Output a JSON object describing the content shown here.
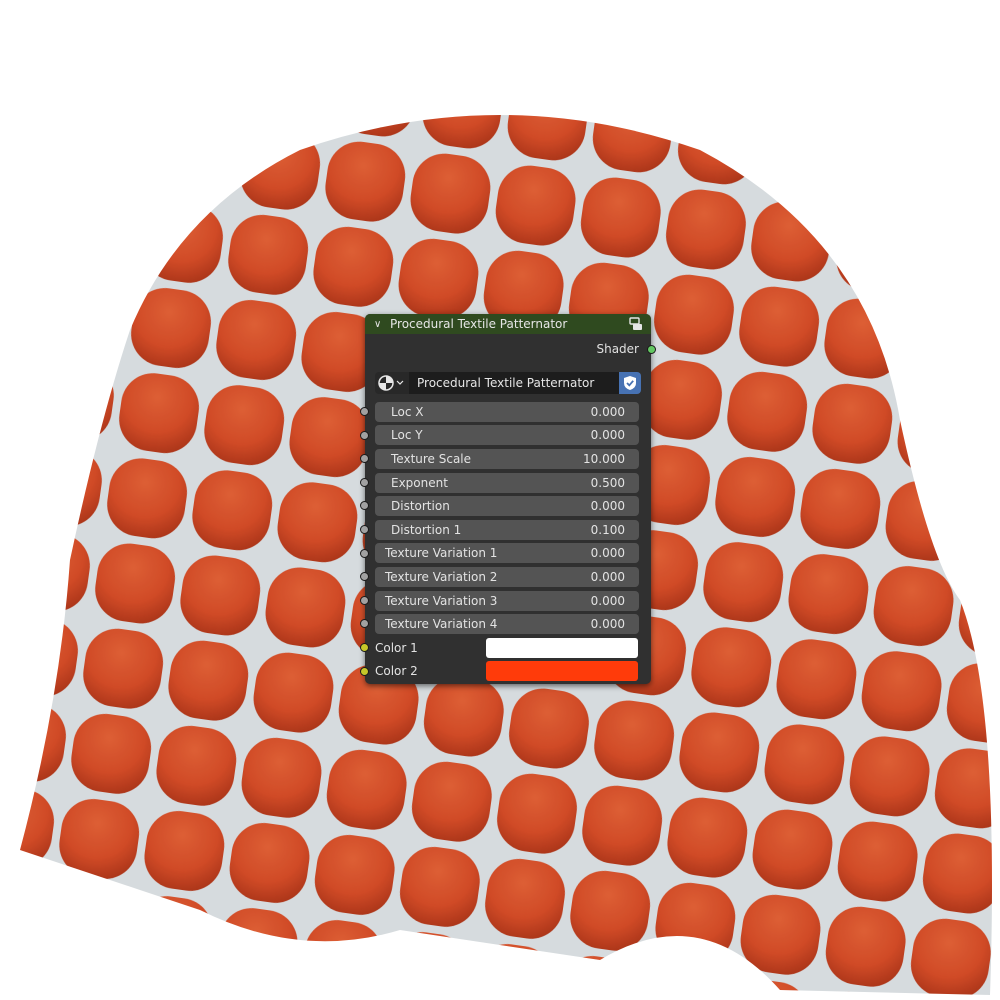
{
  "node": {
    "title": "Procedural Textile Patternator",
    "header_color": "#2f4a1f",
    "output_label": "Shader",
    "group_name": "Procedural Textile Patternator",
    "fields": [
      {
        "label": "Loc X",
        "value": "0.000"
      },
      {
        "label": "Loc Y",
        "value": "0.000"
      },
      {
        "label": "Texture Scale",
        "value": "10.000"
      },
      {
        "label": "Exponent",
        "value": "0.500"
      },
      {
        "label": "Distortion",
        "value": "0.000"
      },
      {
        "label": "Distortion 1",
        "value": "0.100"
      },
      {
        "label": "Texture Variation 1",
        "value": "0.000"
      },
      {
        "label": "Texture Variation 2",
        "value": "0.000"
      },
      {
        "label": "Texture Variation 3",
        "value": "0.000"
      },
      {
        "label": "Texture Variation 4",
        "value": "0.000"
      }
    ],
    "colors": [
      {
        "label": "Color 1",
        "value": "#ffffff"
      },
      {
        "label": "Color 2",
        "value": "#ff3b0a"
      }
    ]
  },
  "scene": {
    "fabric_color": "#e8582a",
    "pattern_color": "#e8eef2"
  }
}
